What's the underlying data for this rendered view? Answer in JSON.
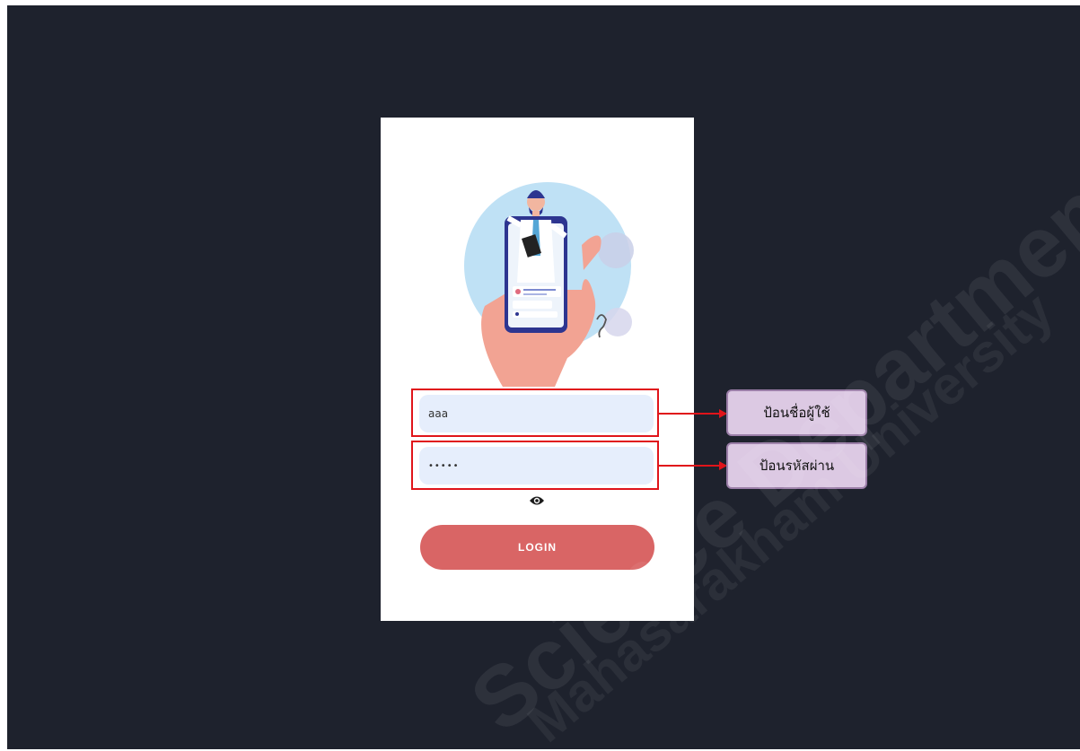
{
  "login_form": {
    "username_value": "aaa",
    "password_value": "•••••",
    "login_label": "LOGIN"
  },
  "annotations": {
    "username_note": "ป้อนชื่อผู้ใช้",
    "password_note": "ป้อนรหัสผ่าน"
  },
  "watermark": {
    "line1": "Science Department",
    "line2": "Mahasarakham University"
  },
  "colors": {
    "background": "#1e222d",
    "field": "#e6eefc",
    "button": "#d96565",
    "highlight": "#e0141a",
    "callout": "#dcc9e3"
  }
}
